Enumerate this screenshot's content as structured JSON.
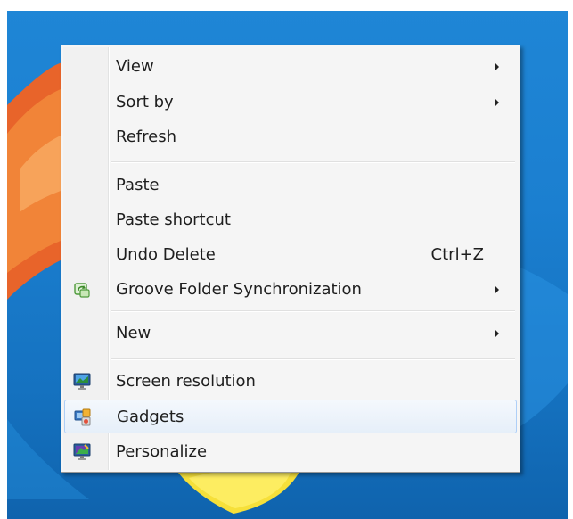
{
  "context_menu": {
    "items": [
      {
        "label": "View",
        "has_submenu": true
      },
      {
        "label": "Sort by",
        "has_submenu": true
      },
      {
        "label": "Refresh",
        "has_submenu": false
      },
      {
        "label": "Paste",
        "has_submenu": false
      },
      {
        "label": "Paste shortcut",
        "has_submenu": false
      },
      {
        "label": "Undo Delete",
        "shortcut": "Ctrl+Z",
        "has_submenu": false
      },
      {
        "label": "Groove Folder Synchronization",
        "icon": "groove-sync-icon",
        "has_submenu": true
      },
      {
        "label": "New",
        "has_submenu": true
      },
      {
        "label": "Screen resolution",
        "icon": "monitor-icon",
        "has_submenu": false
      },
      {
        "label": "Gadgets",
        "icon": "gadgets-icon",
        "has_submenu": false,
        "highlighted": true
      },
      {
        "label": "Personalize",
        "icon": "personalize-icon",
        "has_submenu": false
      }
    ]
  },
  "colors": {
    "desktop_blue": "#1b7fd0",
    "menu_background": "#f5f5f5",
    "highlight_border": "#aecff7",
    "highlight_fill": "#e6eff9"
  }
}
